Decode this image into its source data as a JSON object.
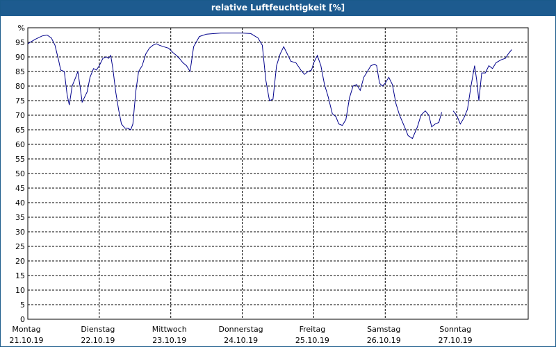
{
  "header": {
    "title": "relative Luftfeuchtigkeit [%]"
  },
  "colors": {
    "title_bar": "#1d5b8f",
    "line": "#00008b",
    "grid": "#000000"
  },
  "chart_data": {
    "type": "line",
    "title": "relative Luftfeuchtigkeit [%]",
    "ylabel": "%",
    "xlabel": "",
    "ylim": [
      0,
      100
    ],
    "yticks": [
      0,
      5,
      10,
      15,
      20,
      25,
      30,
      35,
      40,
      45,
      50,
      55,
      60,
      65,
      70,
      75,
      80,
      85,
      90,
      95
    ],
    "xlim": [
      0,
      7
    ],
    "grid": true,
    "day_labels": [
      {
        "day": "Montag",
        "date": "21.10.19"
      },
      {
        "day": "Dienstag",
        "date": "22.10.19"
      },
      {
        "day": "Mittwoch",
        "date": "23.10.19"
      },
      {
        "day": "Donnerstag",
        "date": "24.10.19"
      },
      {
        "day": "Freitag",
        "date": "25.10.19"
      },
      {
        "day": "Samstag",
        "date": "26.10.19"
      },
      {
        "day": "Sonntag",
        "date": "27.10.19"
      }
    ],
    "series": [
      {
        "segments": [
          [
            [
              0.0,
              94.5
            ],
            [
              0.1,
              96
            ],
            [
              0.2,
              97.2
            ],
            [
              0.27,
              97.5
            ],
            [
              0.33,
              96.5
            ],
            [
              0.38,
              94
            ],
            [
              0.43,
              89
            ],
            [
              0.46,
              85.5
            ],
            [
              0.51,
              85
            ],
            [
              0.55,
              77
            ],
            [
              0.58,
              73.5
            ],
            [
              0.62,
              80
            ],
            [
              0.67,
              83
            ],
            [
              0.7,
              85
            ],
            [
              0.73,
              80
            ],
            [
              0.76,
              74.5
            ],
            [
              0.79,
              76
            ],
            [
              0.83,
              78
            ],
            [
              0.87,
              83
            ],
            [
              0.92,
              86
            ],
            [
              0.96,
              85.5
            ],
            [
              1.0,
              87
            ],
            [
              1.05,
              89.5
            ],
            [
              1.1,
              90
            ],
            [
              1.13,
              89.5
            ],
            [
              1.16,
              90.5
            ],
            [
              1.19,
              86
            ],
            [
              1.23,
              78
            ],
            [
              1.27,
              72
            ],
            [
              1.31,
              67
            ],
            [
              1.36,
              65.5
            ],
            [
              1.4,
              65.5
            ],
            [
              1.44,
              65
            ],
            [
              1.47,
              67
            ],
            [
              1.51,
              78
            ],
            [
              1.55,
              85
            ],
            [
              1.6,
              87
            ],
            [
              1.65,
              91
            ],
            [
              1.7,
              93
            ],
            [
              1.75,
              94
            ],
            [
              1.8,
              94.5
            ],
            [
              1.84,
              94
            ],
            [
              1.9,
              93.5
            ],
            [
              1.97,
              93
            ],
            [
              2.03,
              91.5
            ],
            [
              2.08,
              90.5
            ],
            [
              2.12,
              89.5
            ],
            [
              2.17,
              88
            ],
            [
              2.22,
              87
            ],
            [
              2.27,
              85
            ],
            [
              2.32,
              93.5
            ],
            [
              2.4,
              97
            ],
            [
              2.5,
              97.8
            ],
            [
              2.7,
              98.2
            ],
            [
              2.9,
              98.2
            ],
            [
              3.0,
              98.2
            ],
            [
              3.12,
              98
            ],
            [
              3.22,
              96.5
            ],
            [
              3.28,
              94
            ],
            [
              3.33,
              82
            ],
            [
              3.38,
              75
            ],
            [
              3.43,
              75.5
            ],
            [
              3.48,
              87
            ],
            [
              3.53,
              91
            ],
            [
              3.58,
              93.5
            ],
            [
              3.63,
              91
            ],
            [
              3.68,
              88.5
            ],
            [
              3.75,
              88
            ],
            [
              3.82,
              85.5
            ],
            [
              3.87,
              84
            ],
            [
              3.92,
              85
            ],
            [
              3.97,
              85.5
            ],
            [
              4.0,
              88
            ],
            [
              4.05,
              90.5
            ],
            [
              4.1,
              87
            ],
            [
              4.15,
              80.5
            ],
            [
              4.2,
              76.5
            ],
            [
              4.26,
              70.5
            ],
            [
              4.31,
              69.5
            ],
            [
              4.35,
              67
            ],
            [
              4.4,
              66.5
            ],
            [
              4.45,
              68.5
            ],
            [
              4.5,
              76
            ],
            [
              4.55,
              80
            ],
            [
              4.6,
              80.5
            ],
            [
              4.65,
              78.5
            ],
            [
              4.7,
              83
            ],
            [
              4.75,
              85
            ],
            [
              4.8,
              87
            ],
            [
              4.85,
              87.5
            ],
            [
              4.88,
              87
            ],
            [
              4.92,
              81
            ],
            [
              4.96,
              80
            ],
            [
              5.0,
              81
            ],
            [
              5.05,
              83
            ],
            [
              5.1,
              80.5
            ],
            [
              5.15,
              74
            ],
            [
              5.2,
              70
            ],
            [
              5.27,
              66
            ],
            [
              5.32,
              63
            ],
            [
              5.38,
              62
            ],
            [
              5.45,
              66
            ],
            [
              5.5,
              70
            ],
            [
              5.56,
              71.5
            ],
            [
              5.61,
              70
            ],
            [
              5.65,
              66
            ],
            [
              5.7,
              67
            ],
            [
              5.75,
              67.5
            ],
            [
              5.79,
              71
            ]
          ],
          [
            [
              5.95,
              71.5
            ],
            [
              6.0,
              70
            ],
            [
              6.05,
              67
            ],
            [
              6.1,
              69
            ],
            [
              6.15,
              72
            ],
            [
              6.2,
              80
            ],
            [
              6.25,
              87
            ],
            [
              6.28,
              82
            ],
            [
              6.31,
              75
            ],
            [
              6.35,
              84.5
            ],
            [
              6.4,
              84.5
            ],
            [
              6.45,
              87
            ],
            [
              6.5,
              86
            ],
            [
              6.55,
              88
            ],
            [
              6.62,
              89
            ],
            [
              6.68,
              89.5
            ],
            [
              6.72,
              91
            ],
            [
              6.77,
              92.5
            ]
          ]
        ]
      }
    ]
  }
}
